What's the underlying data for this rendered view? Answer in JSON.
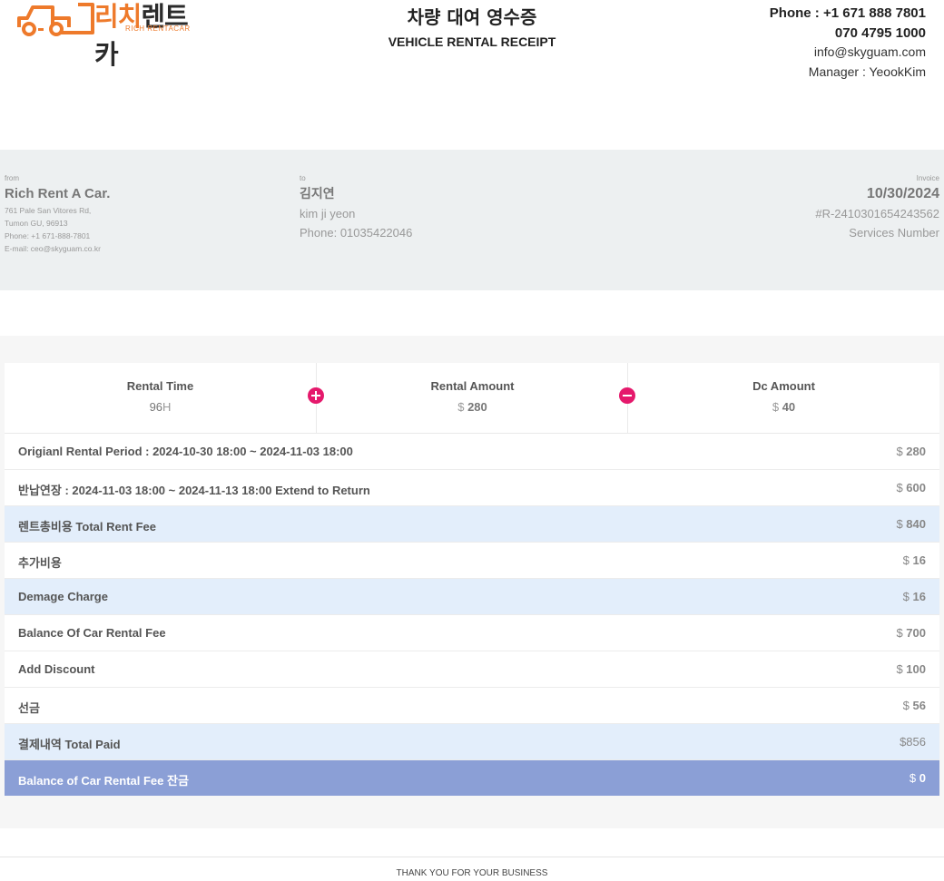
{
  "logo": {
    "korean_orange": "리치",
    "korean_dark": "렌트카",
    "english": "RICH RENTACAR"
  },
  "title": {
    "korean": "차량 대여 영수증",
    "english": "VEHICLE RENTAL RECEIPT"
  },
  "contact": {
    "phone": "Phone : +1 671 888 7801",
    "phone2": "070 4795 1000",
    "email": "info@skyguam.com",
    "manager": "Manager : YeookKim"
  },
  "from": {
    "label": "from",
    "name": "Rich Rent A Car.",
    "address1": "761 Pale San Vitores Rd,",
    "address2": "Tumon GU, 96913",
    "phone": "Phone: +1 671-888-7801",
    "email": "E-mail: ceo@skyguam.co.kr"
  },
  "to": {
    "label": "to",
    "name_korean": "김지연",
    "name_english": "kim ji yeon",
    "phone": "Phone: 01035422046"
  },
  "invoice": {
    "label": "Invoice",
    "date": "10/30/2024",
    "number": "#R-2410301654243562",
    "services": "Services Number"
  },
  "summary": [
    {
      "label": "Rental Time",
      "value": "96",
      "unit": "H"
    },
    {
      "label": "Rental Amount",
      "prefix": "$",
      "value": "280"
    },
    {
      "label": "Dc Amount",
      "prefix": "$",
      "value": "40"
    }
  ],
  "rows": [
    {
      "label": "Origianl Rental Period : 2024-10-30 18:00 ~ 2024-11-03 18:00",
      "prefix": "$",
      "amount": "280"
    },
    {
      "label": "반납연장 : 2024-11-03 18:00 ~ 2024-11-13 18:00 Extend to Return",
      "prefix": "$",
      "amount": "600"
    },
    {
      "label": "렌트총비용 Total Rent Fee",
      "prefix": "$",
      "amount": "840"
    },
    {
      "label": "추가비용",
      "prefix": "$",
      "amount": "16"
    },
    {
      "label": "Demage Charge",
      "prefix": "$",
      "amount": "16"
    },
    {
      "label": "Balance Of Car Rental Fee",
      "prefix": "$",
      "amount": "700"
    },
    {
      "label": "Add Discount",
      "prefix": "$",
      "amount": "100"
    },
    {
      "label": "선금",
      "prefix": "$",
      "amount": "56"
    },
    {
      "label": "결제내역 Total Paid",
      "prefix": "$",
      "amount": "856"
    },
    {
      "label": "Balance of Car Rental Fee 잔금",
      "prefix": "$",
      "amount": "0"
    }
  ],
  "footer": "THANK YOU FOR YOUR BUSINESS",
  "colors": {
    "brand_orange": "#ee7a2b",
    "accent_pink": "#e5196c",
    "highlight_blue": "#e3eefb",
    "total_blue": "#8b9fd6"
  }
}
